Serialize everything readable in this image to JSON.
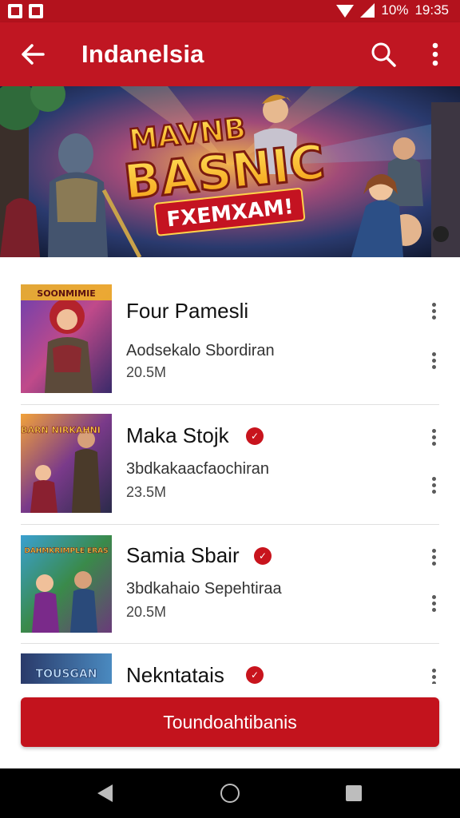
{
  "status_bar": {
    "battery": "10%",
    "time": "19:35"
  },
  "app_bar": {
    "title": "Indanelsia",
    "back_icon": "arrow-left-icon",
    "search_icon": "search-icon",
    "menu_icon": "more-vert-icon"
  },
  "banner": {
    "line1": "MAVNB",
    "line2": "BASNIC",
    "line3": "FXEMXAM!"
  },
  "games": [
    {
      "name": "Four Pamesli",
      "subtitle": "Aodsekalo Sbordiran",
      "size": "20.5M",
      "verified": false,
      "thumb_text": "SOONMIMIE"
    },
    {
      "name": "Maka Stojk",
      "subtitle": "3bdkakaacfaochiran",
      "size": "23.5M",
      "verified": true,
      "thumb_text": "BARN NIRKAHNI"
    },
    {
      "name": "Samia Sbair",
      "subtitle": "3bdkahaio Sepehtiraa",
      "size": "20.5M",
      "verified": true,
      "thumb_text": "DAHMKRIMPLE ERAS"
    },
    {
      "name": "Nekntatais",
      "subtitle": "",
      "size": "",
      "verified": true,
      "thumb_text": "TOUSGAN"
    }
  ],
  "cta": {
    "label": "Toundoahtibanis"
  },
  "colors": {
    "primary": "#c01622",
    "status": "#b3121d",
    "badge": "#c8141d"
  }
}
